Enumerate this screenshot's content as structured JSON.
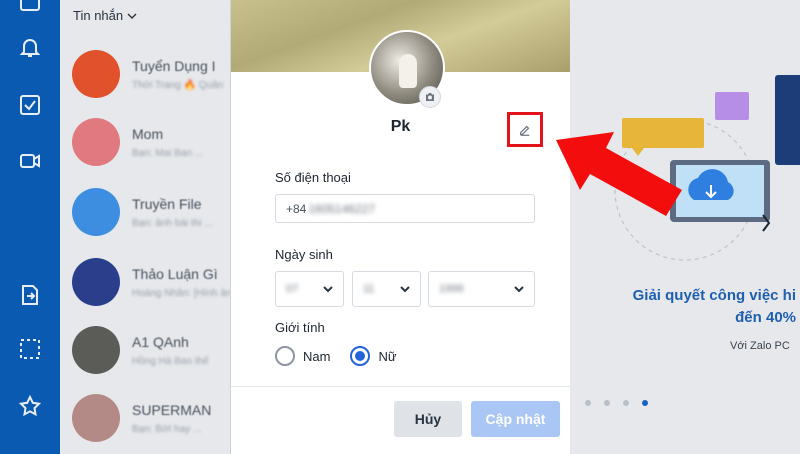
{
  "colors": {
    "rail": "#0b5ab1",
    "accent": "#2563d8",
    "highlight": "#e3131b",
    "arrow": "#f40d0d"
  },
  "rail": {
    "icons": [
      "chat-icon",
      "bell-icon",
      "checkbox-icon",
      "video-icon",
      "share-icon",
      "screenshot-icon",
      "star-icon"
    ]
  },
  "conversations": {
    "header": "Tin nhắn",
    "items": [
      {
        "name": "Tuyển Dụng I",
        "preview": "Thời Trang 🔥 Quần"
      },
      {
        "name": "Mom",
        "preview": "Bạn: Mai Ban ..."
      },
      {
        "name": "Truyền File",
        "preview": "Bạn: ảnh bài thi ..."
      },
      {
        "name": "Thảo Luận Gì",
        "preview": "Hoàng Nhân: [Hình ảnh]"
      },
      {
        "name": "A1 QAnh",
        "preview": "Hồng Hà Bao thế"
      },
      {
        "name": "SUPERMAN",
        "preview": "Bạn: Bớt hay ..."
      }
    ]
  },
  "promo": {
    "headline_line1": "Giải quyết công việc hi",
    "headline_line2": "đến 40%",
    "subtitle": "Với Zalo PC"
  },
  "profile": {
    "display_name": "Pk",
    "phone_label": "Số điện thoại",
    "phone_prefix": "+84",
    "phone_hidden": "1605146227",
    "birthday_label": "Ngày sinh",
    "birthday": {
      "day": "07",
      "month": "11",
      "year": "1999"
    },
    "gender_label": "Giới tính",
    "gender_male": "Nam",
    "gender_female": "Nữ",
    "gender_selected": "Nữ",
    "cancel": "Hủy",
    "update": "Cập nhật"
  }
}
